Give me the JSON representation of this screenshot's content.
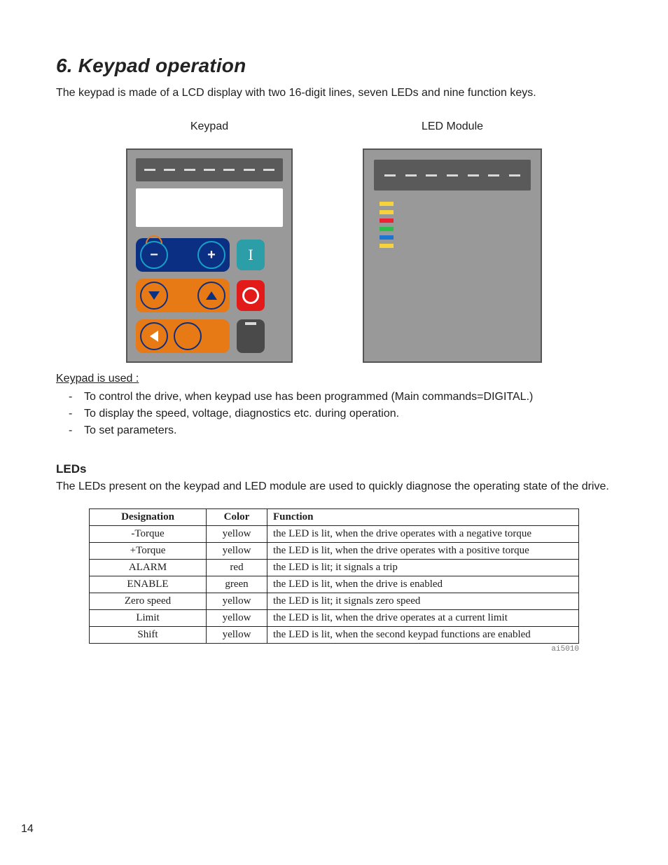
{
  "heading": "6. Keypad operation",
  "intro": "The keypad is made of a LCD display with two 16-digit lines, seven LEDs and nine function keys.",
  "fig": {
    "keypad_label": "Keypad",
    "ledmodule_label": "LED Module"
  },
  "keypad_used": {
    "title": "Keypad  is used :",
    "items": [
      "To control the drive, when keypad use has been programmed (Main commands=DIGITAL.)",
      "To display the speed, voltage, diagnostics etc. during operation.",
      "To set parameters."
    ]
  },
  "leds_section": {
    "title": "LEDs",
    "para": "The LEDs present on the keypad and LED module are used to quickly diagnose the operating state of the drive."
  },
  "table": {
    "headers": {
      "designation": "Designation",
      "color": "Color",
      "function": "Function"
    },
    "rows": [
      {
        "designation": "-Torque",
        "color": "yellow",
        "function": "the LED is lit, when the drive operates with a negative torque"
      },
      {
        "designation": "+Torque",
        "color": "yellow",
        "function": "the LED is lit, when the drive operates with a positive torque"
      },
      {
        "designation": "ALARM",
        "color": "red",
        "function": "the LED is lit; it signals a trip"
      },
      {
        "designation": "ENABLE",
        "color": "green",
        "function": "the LED is lit, when the drive is enabled"
      },
      {
        "designation": "Zero speed",
        "color": "yellow",
        "function": "the LED is lit; it signals zero speed"
      },
      {
        "designation": "Limit",
        "color": "yellow",
        "function": "the LED is lit, when the drive operates at a current limit"
      },
      {
        "designation": "Shift",
        "color": "yellow",
        "function": "the LED is lit, when the second keypad functions are enabled"
      }
    ],
    "ref": "ai5010"
  },
  "page_number": "14"
}
